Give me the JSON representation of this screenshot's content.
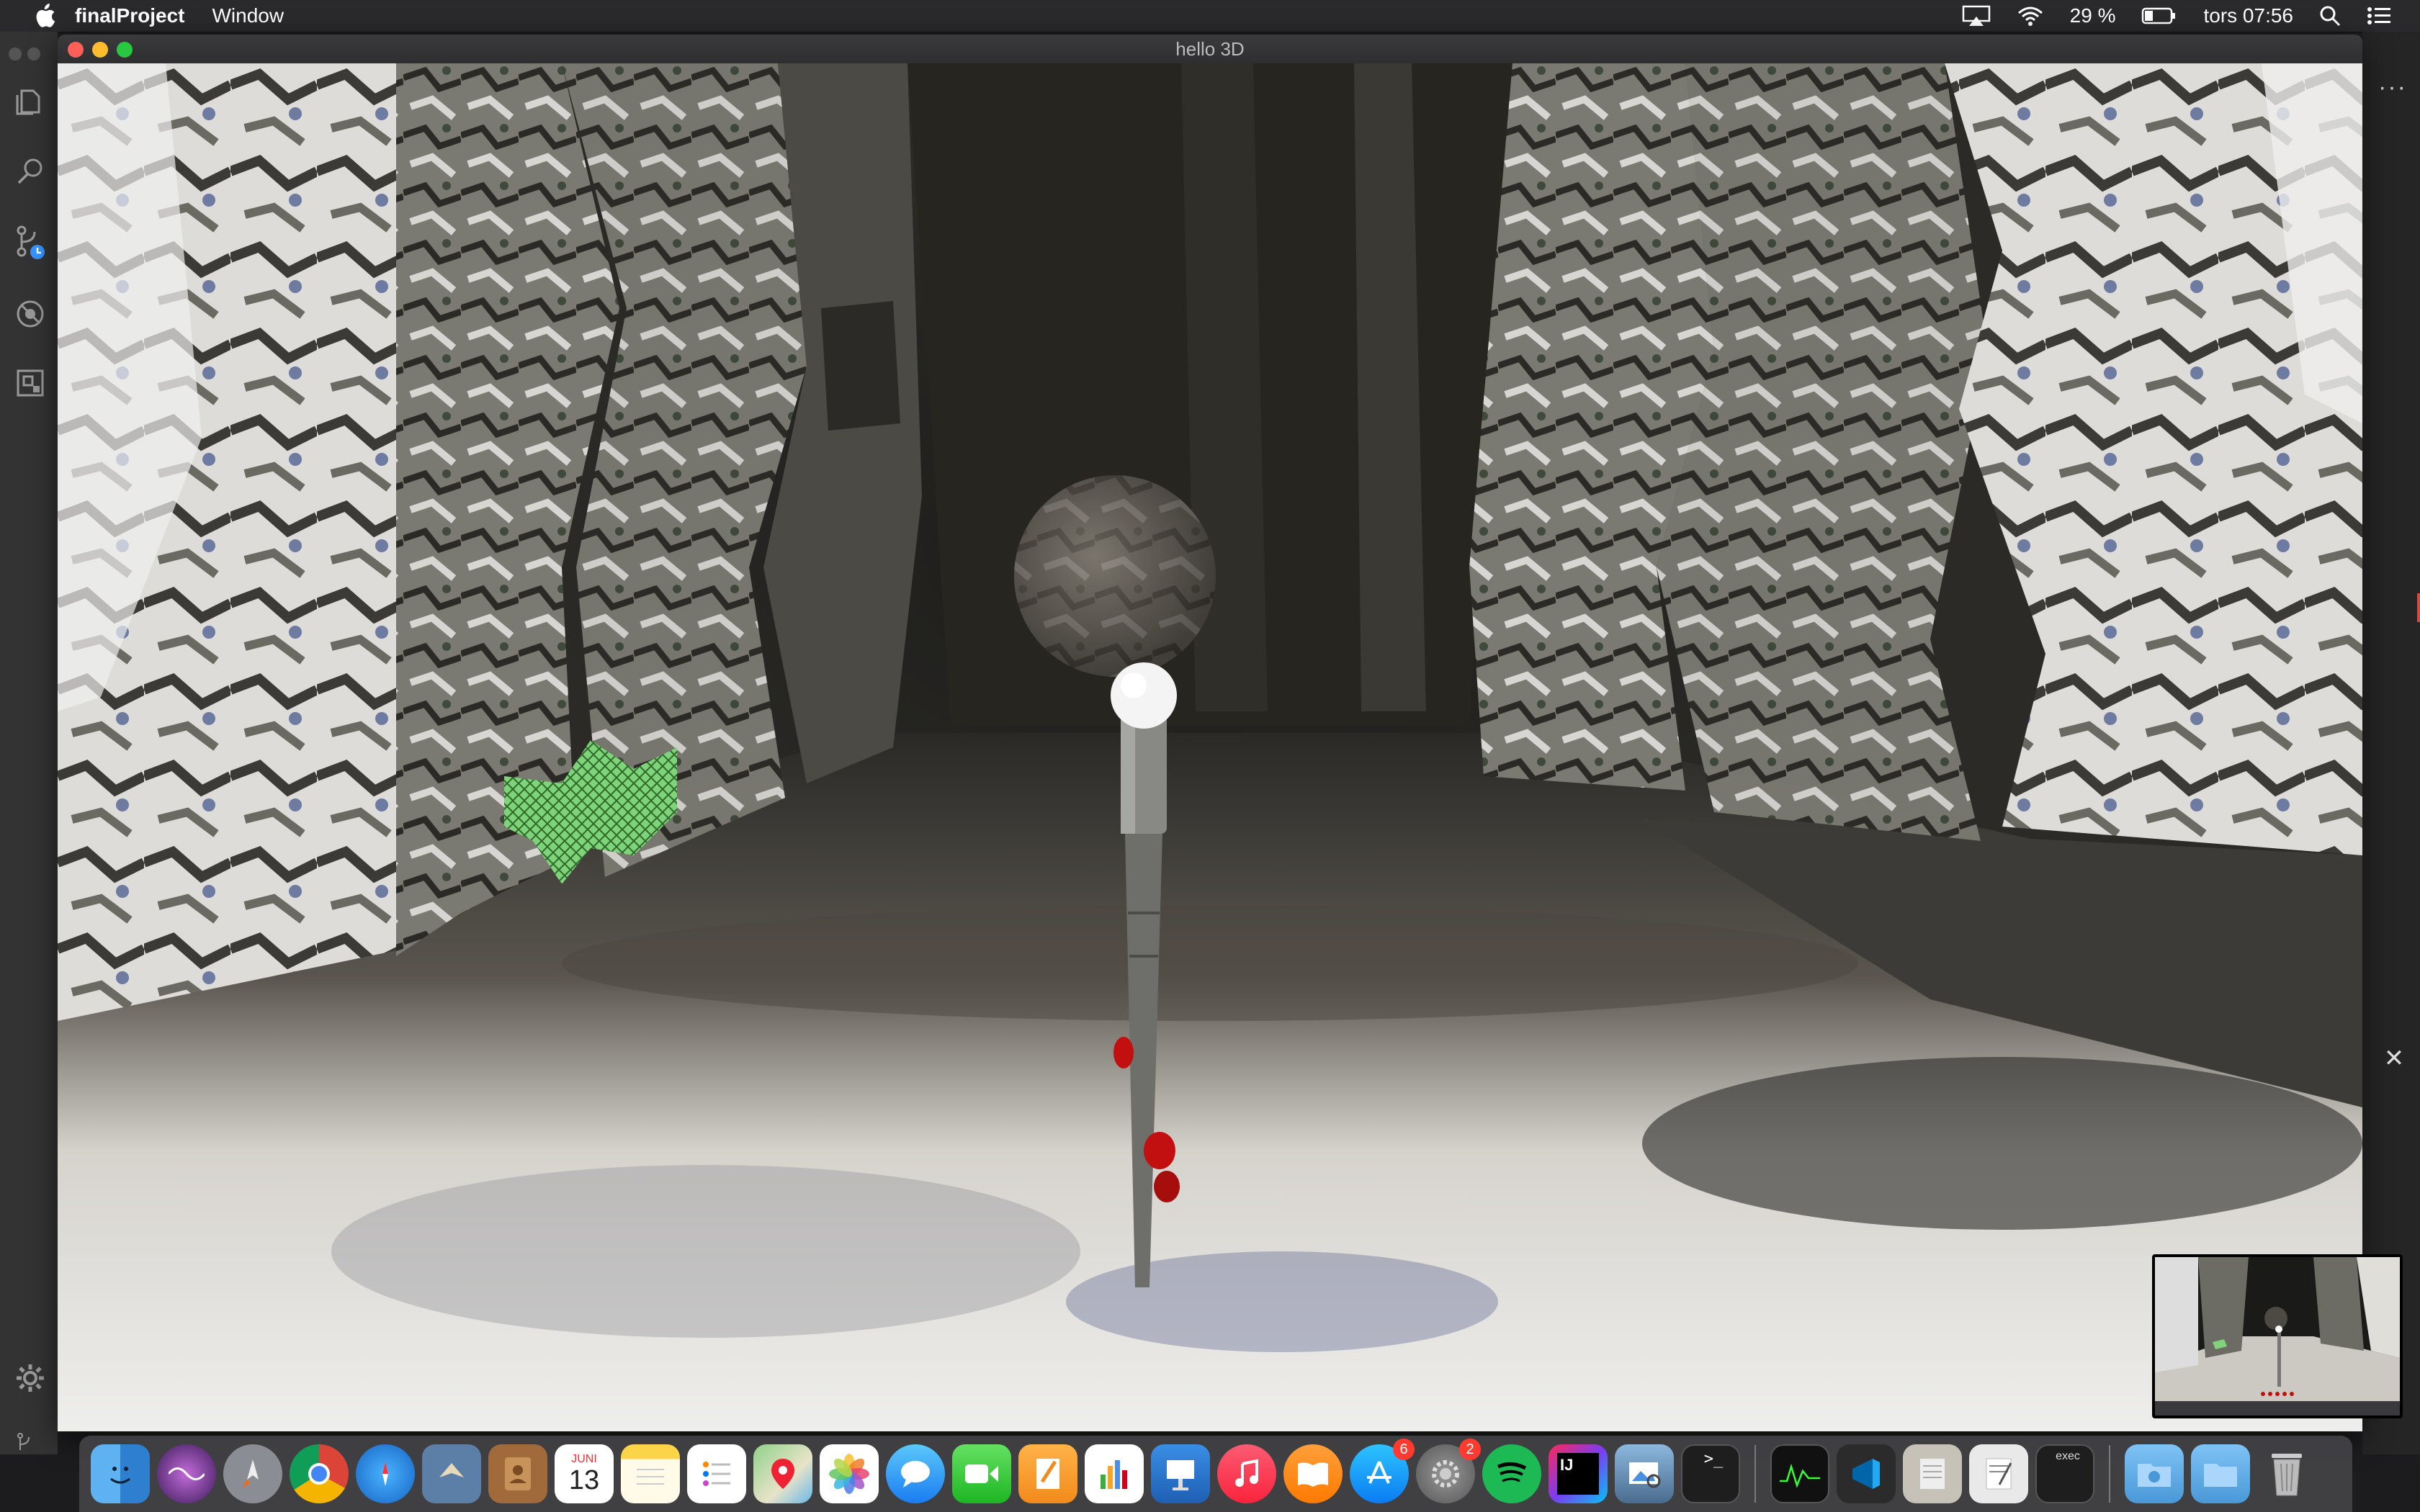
{
  "menubar": {
    "app_name": "finalProject",
    "menu_window": "Window",
    "battery": "29 %",
    "clock": "tors 07:56"
  },
  "window": {
    "title": "hello 3D"
  },
  "dock": {
    "calendar_month": "JUNI",
    "calendar_day": "13",
    "appstore_badge": "6",
    "settings_badge": "2",
    "intellij_label": "IJ",
    "terminal_label": ">_",
    "exec_label": "exec"
  },
  "scene": {
    "ground_color": "#d9d6d0",
    "wall_color": "#6b6a62",
    "ball_color": "#5c5650",
    "plant_color": "#7fd37a",
    "stick_color": "#7a7a7a",
    "stick_tip_color": "#ffffff",
    "ladybug_color": "#c21010"
  }
}
